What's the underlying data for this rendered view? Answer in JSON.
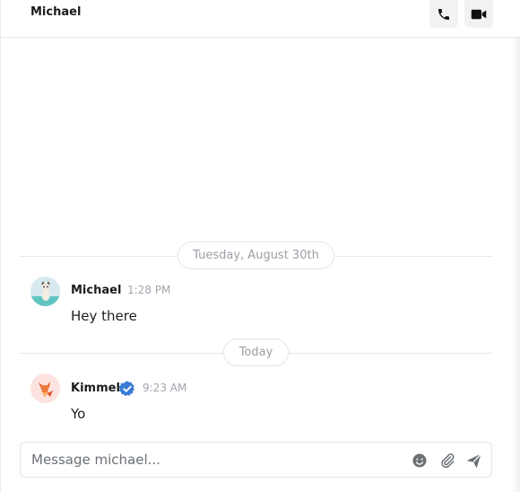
{
  "header": {
    "title": "Michael",
    "call_icon": "phone-icon",
    "video_icon": "video-camera-icon"
  },
  "dividers": {
    "first": "Tuesday, August 30th",
    "second": "Today"
  },
  "messages": [
    {
      "author": "Michael",
      "time": "1:28 PM",
      "text": "Hey there",
      "avatar": "cat-avatar",
      "verified": false
    },
    {
      "author": "Kimmel",
      "time": "9:23 AM",
      "text": "Yo",
      "avatar": "fox-avatar",
      "verified": true
    }
  ],
  "composer": {
    "placeholder": "Message michael...",
    "value": "",
    "icons": [
      "emoji-icon",
      "paperclip-icon",
      "send-icon"
    ]
  },
  "colors": {
    "verified": "#3a7bd5",
    "muted_text": "#a0a6ad",
    "icon": "#6b7075"
  }
}
